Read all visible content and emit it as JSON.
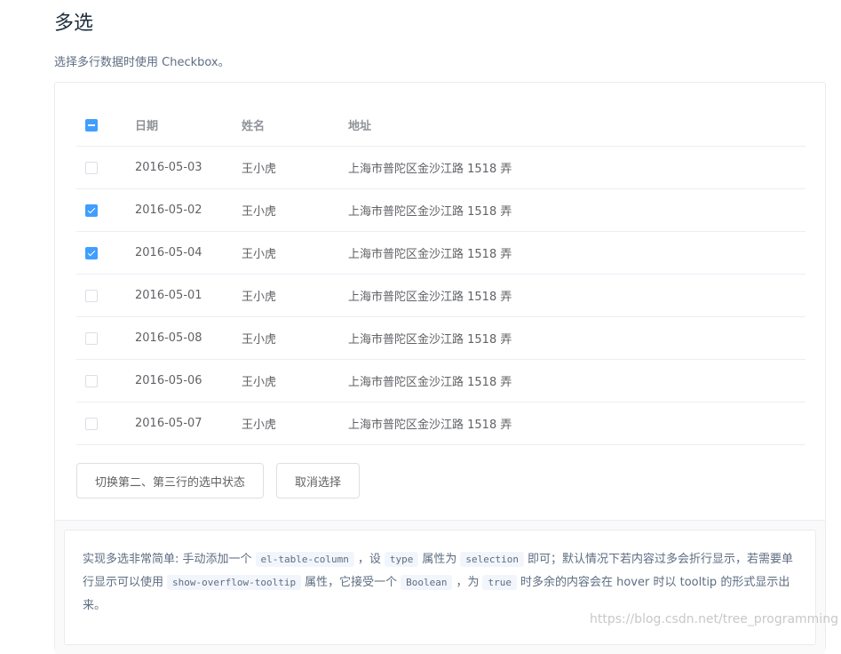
{
  "page": {
    "title": "多选",
    "description": "选择多行数据时使用 Checkbox。"
  },
  "table": {
    "headers": {
      "date": "日期",
      "name": "姓名",
      "address": "地址"
    },
    "header_checkbox_state": "indeterminate",
    "rows": [
      {
        "date": "2016-05-03",
        "name": "王小虎",
        "address": "上海市普陀区金沙江路 1518 弄",
        "checked": false
      },
      {
        "date": "2016-05-02",
        "name": "王小虎",
        "address": "上海市普陀区金沙江路 1518 弄",
        "checked": true
      },
      {
        "date": "2016-05-04",
        "name": "王小虎",
        "address": "上海市普陀区金沙江路 1518 弄",
        "checked": true
      },
      {
        "date": "2016-05-01",
        "name": "王小虎",
        "address": "上海市普陀区金沙江路 1518 弄",
        "checked": false
      },
      {
        "date": "2016-05-08",
        "name": "王小虎",
        "address": "上海市普陀区金沙江路 1518 弄",
        "checked": false
      },
      {
        "date": "2016-05-06",
        "name": "王小虎",
        "address": "上海市普陀区金沙江路 1518 弄",
        "checked": false
      },
      {
        "date": "2016-05-07",
        "name": "王小虎",
        "address": "上海市普陀区金沙江路 1518 弄",
        "checked": false
      }
    ]
  },
  "buttons": {
    "toggle_label": "切换第二、第三行的选中状态",
    "clear_label": "取消选择"
  },
  "meta": {
    "t1": "实现多选非常简单: 手动添加一个",
    "c1": "el-table-column",
    "t2": "，设",
    "c2": "type",
    "t3": "属性为",
    "c3": "selection",
    "t4": "即可；默认情况下若内容过多会折行显示，若需要单行显示可以使用",
    "c4": "show-overflow-tooltip",
    "t5": "属性，它接受一个",
    "c5": "Boolean",
    "t6": "，为",
    "c6": "true",
    "t7": "时多余的内容会在 hover 时以 tooltip 的形式显示出来。"
  },
  "watermark": "https://blog.csdn.net/tree_programming",
  "colors": {
    "primary": "#409eff",
    "border": "#ebeef5",
    "text": "#606266",
    "header_text": "#909399"
  }
}
